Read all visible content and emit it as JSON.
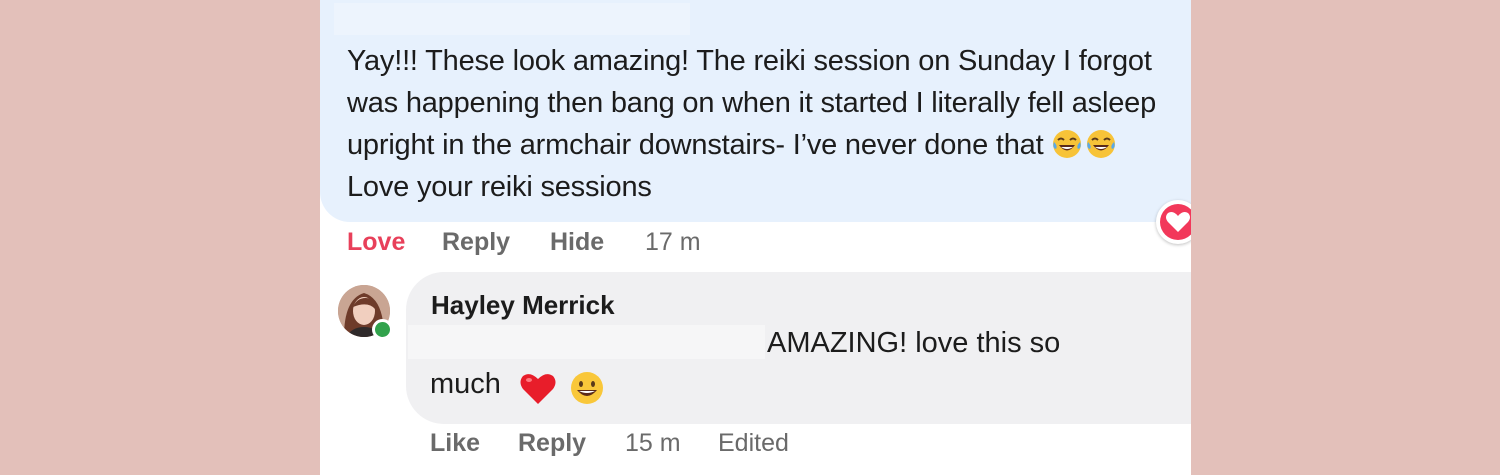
{
  "colors": {
    "background": "#e3c0ba",
    "comment_bubble": "#e7f1fd",
    "reply_bubble": "#f0f0f2",
    "love_accent": "#e8405a",
    "online_green": "#31a24c"
  },
  "comment": {
    "text_before_emoji": "Yay!!! These look amazing! The reiki session on Sunday I forgot was happening then bang on when it started I literally fell asleep upright in the armchair downstairs- I’ve never done that",
    "emojis": [
      "face-with-tears-of-joy",
      "face-with-tears-of-joy"
    ],
    "text_after_emoji": "Love your reiki sessions",
    "reaction": "love-heart-icon",
    "actions": {
      "love": "Love",
      "reply": "Reply",
      "hide": "Hide",
      "time": "17 m"
    }
  },
  "reply": {
    "author": "Hayley Merrick",
    "text_line1": "AMAZING! love this so",
    "text_line2": "much",
    "emojis": [
      "red-heart",
      "grinning-face"
    ],
    "actions": {
      "like": "Like",
      "reply": "Reply",
      "time": "15 m",
      "edited": "Edited"
    }
  }
}
